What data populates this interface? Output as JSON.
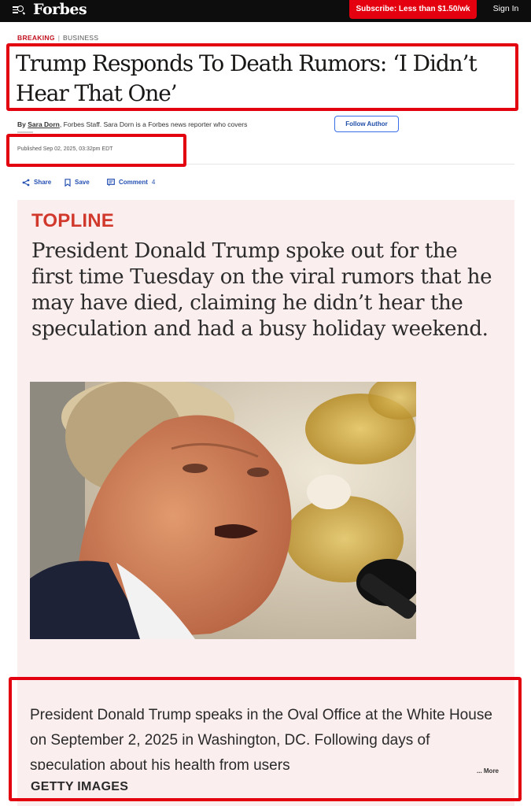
{
  "header": {
    "logo": "Forbes",
    "subscribe_label": "Subscribe: Less than $1.50/wk",
    "signin_label": "Sign In",
    "colors": {
      "bar": "#0d0d0d",
      "subscribe": "#e4000f"
    }
  },
  "article": {
    "eyebrow": {
      "breaking": "BREAKING",
      "section": "BUSINESS"
    },
    "headline": "Trump Responds To Death Rumors: ‘I Didn’t Hear That One’",
    "byline": {
      "prefix": "By",
      "author": "Sara Dorn",
      "staff": "Forbes Staff.",
      "bio": "Sara Dorn is a Forbes news reporter who covers"
    },
    "follow_label": "Follow Author",
    "published": "Published Sep 02, 2025, 03:32pm EDT",
    "actions": {
      "share": "Share",
      "save": "Save",
      "comment": "Comment",
      "comment_count": "4"
    },
    "topline": {
      "label": "TOPLINE",
      "text": "President Donald Trump spoke out for the first time Tuesday on the viral rumors that he may have died, claiming he didn’t hear the speculation and had a busy holiday weekend."
    },
    "photo": {
      "caption": "President Donald Trump speaks in the Oval Office at the White House on September 2, 2025 in Washington, DC. Following days of speculation about his health from users",
      "more_label": "... More",
      "credit": "GETTY IMAGES"
    }
  },
  "annotations": {
    "highlight_color": "#e3000f"
  }
}
